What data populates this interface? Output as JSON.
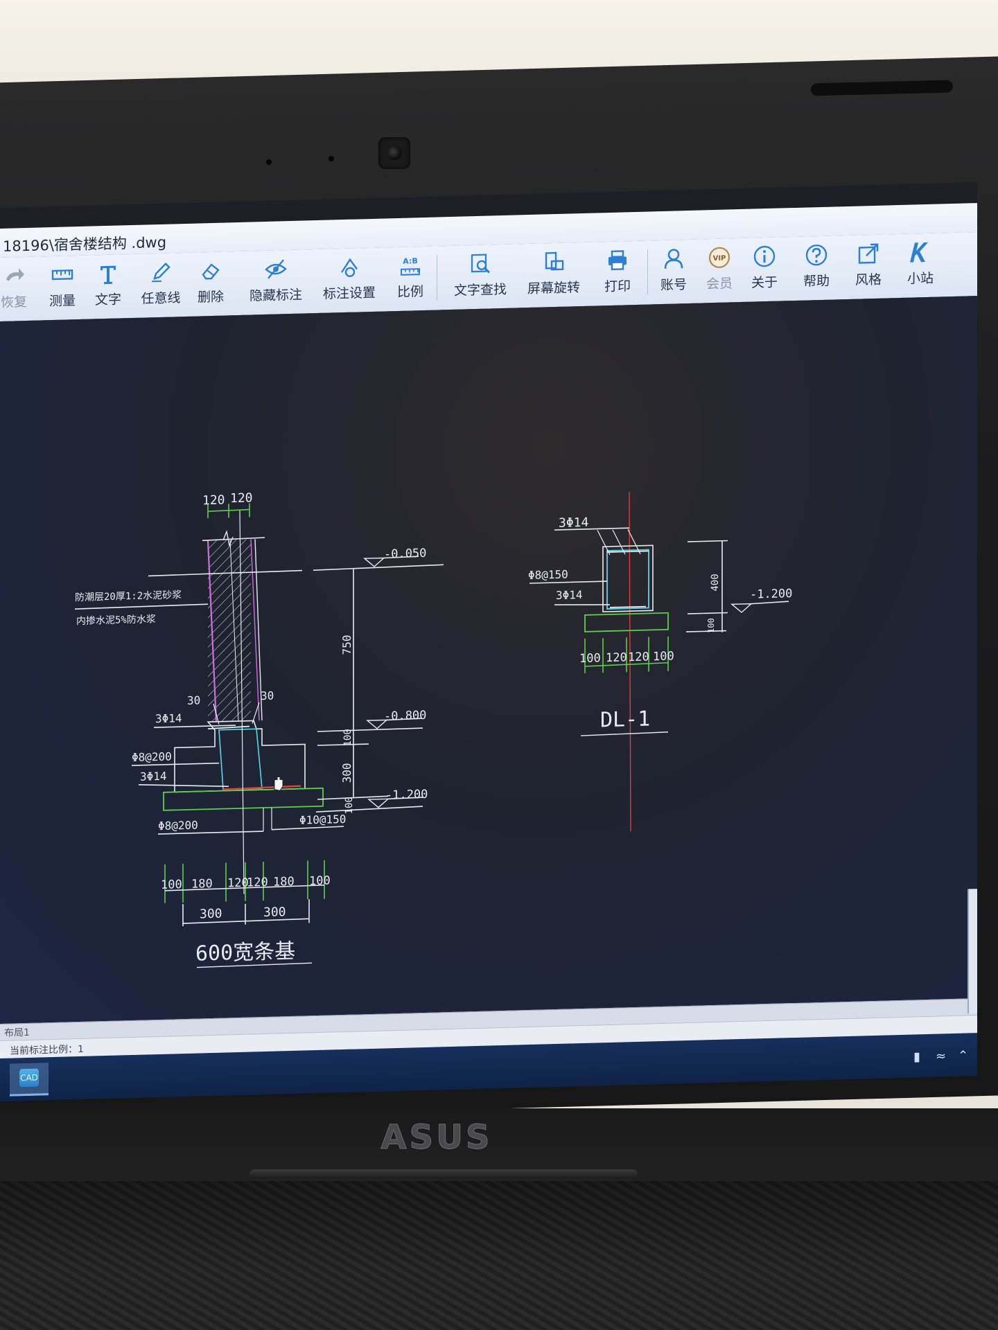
{
  "window": {
    "title": "18196\\宿舍楼结构 .dwg"
  },
  "toolbar": {
    "tools": [
      {
        "label": "恢复",
        "icon": "redo-icon"
      },
      {
        "label": "测量",
        "icon": "ruler-icon"
      },
      {
        "label": "文字",
        "icon": "text-icon"
      },
      {
        "label": "任意线",
        "icon": "pencil-icon"
      },
      {
        "label": "删除",
        "icon": "eraser-icon"
      },
      {
        "label": "隐藏标注",
        "icon": "eye-hide-icon"
      },
      {
        "label": "标注设置",
        "icon": "dimension-settings-icon"
      },
      {
        "label": "比例",
        "icon": "scale-icon",
        "badge": "A:B"
      },
      {
        "label": "文字查找",
        "icon": "text-search-icon"
      },
      {
        "label": "屏幕旋转",
        "icon": "rotate-screen-icon"
      },
      {
        "label": "打印",
        "icon": "printer-icon"
      },
      {
        "label": "账号",
        "icon": "user-icon"
      },
      {
        "label": "会员",
        "icon": "vip-icon",
        "badge": "VIP"
      },
      {
        "label": "关于",
        "icon": "info-icon"
      },
      {
        "label": "帮助",
        "icon": "help-icon"
      },
      {
        "label": "风格",
        "icon": "style-icon"
      },
      {
        "label": "小站",
        "icon": "site-icon"
      }
    ]
  },
  "drawing": {
    "strip_footing": {
      "dims_top": [
        "120",
        "120"
      ],
      "note_1": "防潮层20厚1:2水泥砂浆",
      "note_2": "内掺水泥5%防水浆",
      "dim_30_left": "30",
      "dim_30_right": "30",
      "rebar_top": "3Φ14",
      "stirrup": "Φ8@200",
      "rebar_bottom": "3Φ14",
      "bottom_bar_left": "Φ8@200",
      "bottom_bar_right": "Φ10@150",
      "elevations": [
        "-0.050",
        "-0.800",
        "-1.200"
      ],
      "vertical_dims": [
        "750",
        "100",
        "300",
        "100"
      ],
      "bottom_dims_row1": [
        "100",
        "180",
        "120",
        "120",
        "180",
        "100"
      ],
      "bottom_dims_row2": [
        "300",
        "300"
      ],
      "caption": "600宽条基"
    },
    "ground_beam": {
      "rebar_top": "3Φ14",
      "stirrup": "Φ8@150",
      "rebar_bottom": "3Φ14",
      "height_dim": "400",
      "bottom_dim": "100",
      "elevation": "-1.200",
      "bottom_dims": [
        "100",
        "120",
        "120",
        "100"
      ],
      "caption": "DL-1"
    }
  },
  "status": {
    "layout_tab": "布局1",
    "scale_text": "当前标注比例：1"
  },
  "taskbar": {
    "app_icon_text": "CAD"
  },
  "device": {
    "brand": "ASUS"
  },
  "colors": {
    "line_white": "#e8ecf2",
    "line_cyan": "#5fd4e6",
    "line_magenta": "#d06ee0",
    "line_green": "#5ecf4a",
    "line_red": "#e23c3c",
    "toolbar_icon_blue": "#2c7fd6"
  }
}
